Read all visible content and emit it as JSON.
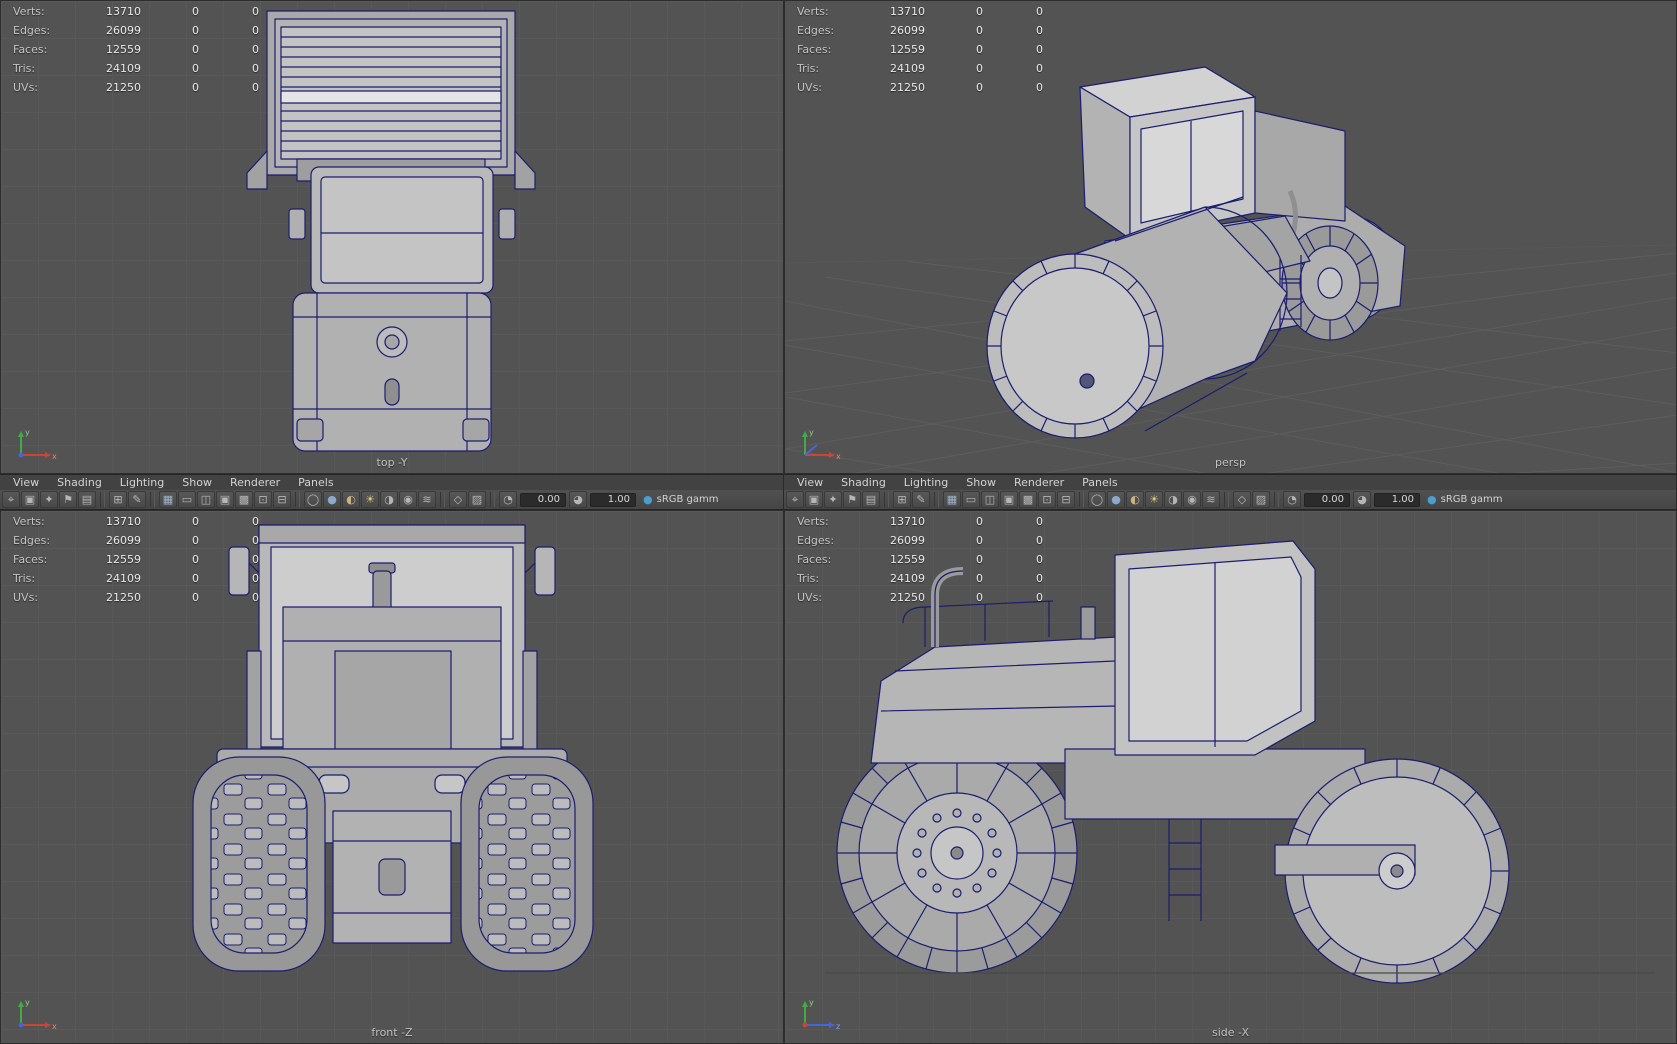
{
  "stats": {
    "rows": [
      {
        "label": "Verts:",
        "value": "13710",
        "col1": "0",
        "col2": "0"
      },
      {
        "label": "Edges:",
        "value": "26099",
        "col1": "0",
        "col2": "0"
      },
      {
        "label": "Faces:",
        "value": "12559",
        "col1": "0",
        "col2": "0"
      },
      {
        "label": "Tris:",
        "value": "24109",
        "col1": "0",
        "col2": "0"
      },
      {
        "label": "UVs:",
        "value": "21250",
        "col1": "0",
        "col2": "0"
      }
    ]
  },
  "panel_menu": [
    "View",
    "Shading",
    "Lighting",
    "Show",
    "Renderer",
    "Panels"
  ],
  "toolbar": {
    "icons": [
      {
        "name": "select-camera-icon",
        "glyph": "⌖"
      },
      {
        "name": "lock-camera-icon",
        "glyph": "▣"
      },
      {
        "name": "camera-attributes-icon",
        "glyph": "✦"
      },
      {
        "name": "bookmarks-icon",
        "glyph": "⚑"
      },
      {
        "name": "image-plane-icon",
        "glyph": "▤"
      },
      {
        "type": "sep"
      },
      {
        "name": "2d-pan-zoom-icon",
        "glyph": "⊞"
      },
      {
        "name": "grease-pencil-icon",
        "glyph": "✎"
      },
      {
        "type": "sep"
      },
      {
        "name": "grid-icon",
        "glyph": "▦",
        "color": "#9fb6cf"
      },
      {
        "name": "film-gate-icon",
        "glyph": "▭"
      },
      {
        "name": "resolution-gate-icon",
        "glyph": "◫"
      },
      {
        "name": "gate-mask-icon",
        "glyph": "▣"
      },
      {
        "name": "field-chart-icon",
        "glyph": "▩"
      },
      {
        "name": "safe-action-icon",
        "glyph": "⊡"
      },
      {
        "name": "safe-title-icon",
        "glyph": "⊟"
      },
      {
        "type": "sep"
      },
      {
        "name": "wireframe-icon",
        "glyph": "◯"
      },
      {
        "name": "shaded-icon",
        "glyph": "●",
        "color": "#8ea8cc"
      },
      {
        "name": "textured-icon",
        "glyph": "◐",
        "color": "#c7b489"
      },
      {
        "name": "use-all-lights-icon",
        "glyph": "☀",
        "color": "#d8c878"
      },
      {
        "name": "shadows-icon",
        "glyph": "◑"
      },
      {
        "name": "ambient-occlusion-icon",
        "glyph": "◉"
      },
      {
        "name": "motion-blur-icon",
        "glyph": "≋"
      },
      {
        "type": "sep"
      },
      {
        "name": "isolate-select-icon",
        "glyph": "◇"
      },
      {
        "name": "xray-icon",
        "glyph": "▨"
      },
      {
        "type": "sep"
      },
      {
        "name": "exposure-toggle-icon",
        "glyph": "◔"
      },
      {
        "type": "field",
        "name": "exposure-field",
        "value": "0.00"
      },
      {
        "name": "gamma-toggle-icon",
        "glyph": "◕"
      },
      {
        "type": "field",
        "name": "gamma-field",
        "value": "1.00"
      },
      {
        "type": "srgb",
        "name": "colorspace-badge",
        "label": "sRGB gamm"
      }
    ]
  },
  "viewports": {
    "top": {
      "label": "top -Y"
    },
    "persp": {
      "label": "persp"
    },
    "front": {
      "label": "front -Z"
    },
    "side": {
      "label": "side -X"
    }
  },
  "axis": {
    "x": "x",
    "y": "y",
    "z": "z"
  },
  "colors": {
    "viewport_bg": "#535353",
    "wireframe": "#1c1c70",
    "model_fill": "#b5b5b5",
    "axis_x": "#cc4433",
    "axis_y": "#44aa44",
    "axis_z": "#4466dd"
  }
}
